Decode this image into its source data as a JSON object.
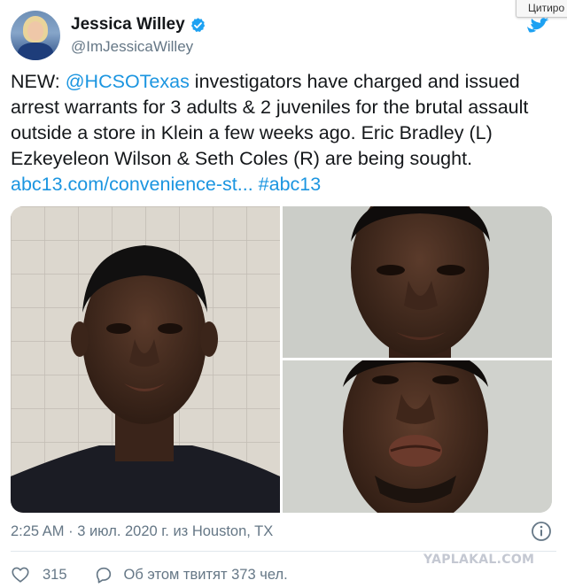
{
  "author": {
    "display_name": "Jessica Willey",
    "handle": "@ImJessicaWilley",
    "verified": true
  },
  "corner_button": {
    "label": "Цитиро"
  },
  "tweet": {
    "lead": "NEW: ",
    "mention": "@HCSOTexas",
    "body": " investigators have charged and issued arrest warrants for 3 adults & 2 juveniles for the brutal assault outside a store in Klein a few weeks ago. Eric Bradley (L) Ezkeyeleon Wilson & Seth Coles (R) are being sought.",
    "link": "abc13.com/convenience-st...",
    "hashtag": "#abc13"
  },
  "media": {
    "photo_count": 3
  },
  "meta": {
    "timestamp": "2:25 AM · 3 июл. 2020 г. из Houston, TX"
  },
  "actions": {
    "like_count": "315",
    "discussion_text": "Об этом твитят 373 чел."
  },
  "watermark": "YAPLAKAL.COM",
  "colors": {
    "link": "#1b95e0",
    "secondary_text": "#657786",
    "verified": "#1da1f2"
  },
  "icons": [
    "verified-icon",
    "twitter-bird-icon",
    "info-icon",
    "heart-icon",
    "reply-icon"
  ]
}
